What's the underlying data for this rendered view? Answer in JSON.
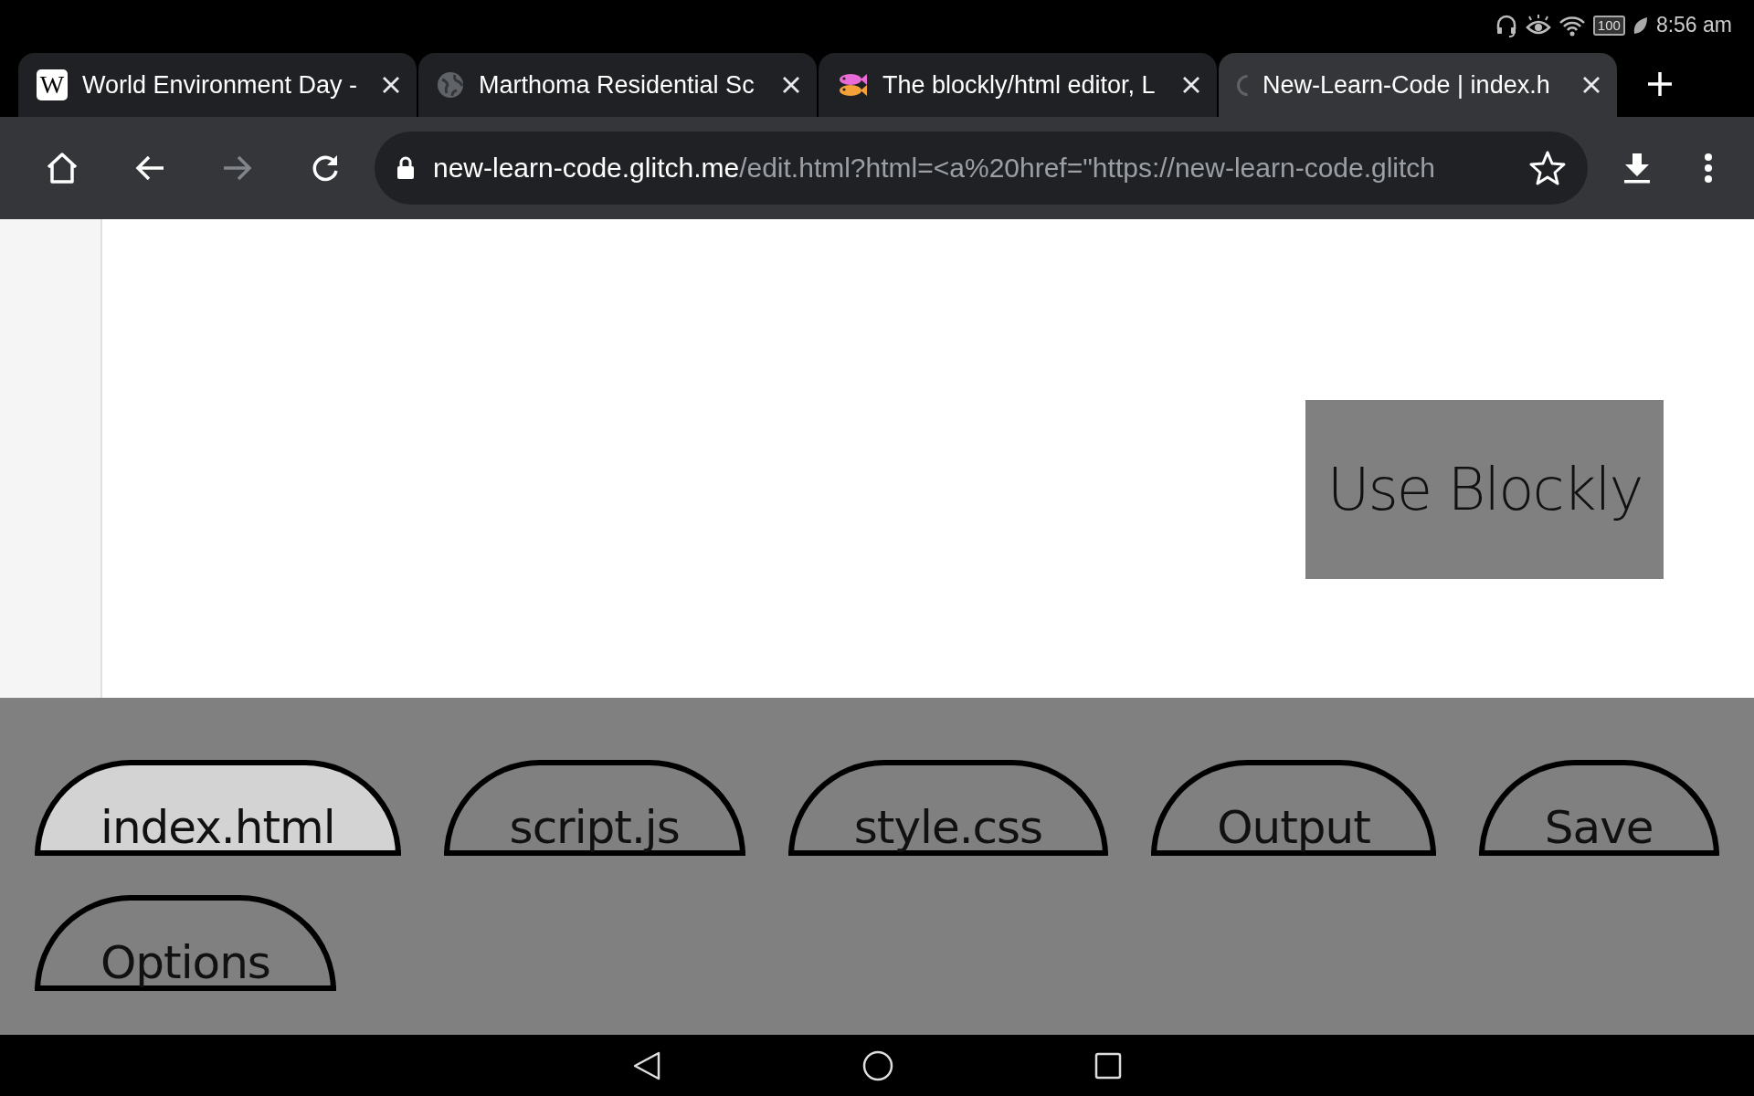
{
  "status_bar": {
    "battery": "100",
    "time": "8:56 am"
  },
  "browser_tabs": [
    {
      "title": "World Environment Day -",
      "favicon": {
        "kind": "letter",
        "text": "W"
      },
      "selected": false
    },
    {
      "title": "Marthoma Residential Sc",
      "favicon": {
        "kind": "globe"
      },
      "selected": false
    },
    {
      "title": "The blockly/html editor, L",
      "favicon": {
        "kind": "fish"
      },
      "selected": false
    },
    {
      "title": "New-Learn-Code | index.h",
      "favicon": {
        "kind": "loading"
      },
      "selected": true
    }
  ],
  "toolbar": {
    "forward_disabled": true,
    "address": {
      "host": "new-learn-code.glitch.me",
      "path": "/edit.html?html=<a%20href=\"https://new-learn-code.glitch"
    }
  },
  "page": {
    "use_blockly_button": "Use Blockly",
    "file_tabs": [
      {
        "label": "index.html",
        "selected": true
      },
      {
        "label": "script.js",
        "selected": false
      },
      {
        "label": "style.css",
        "selected": false
      },
      {
        "label": "Output",
        "selected": false
      },
      {
        "label": "Save",
        "selected": false
      },
      {
        "label": "Options",
        "selected": false
      }
    ]
  }
}
